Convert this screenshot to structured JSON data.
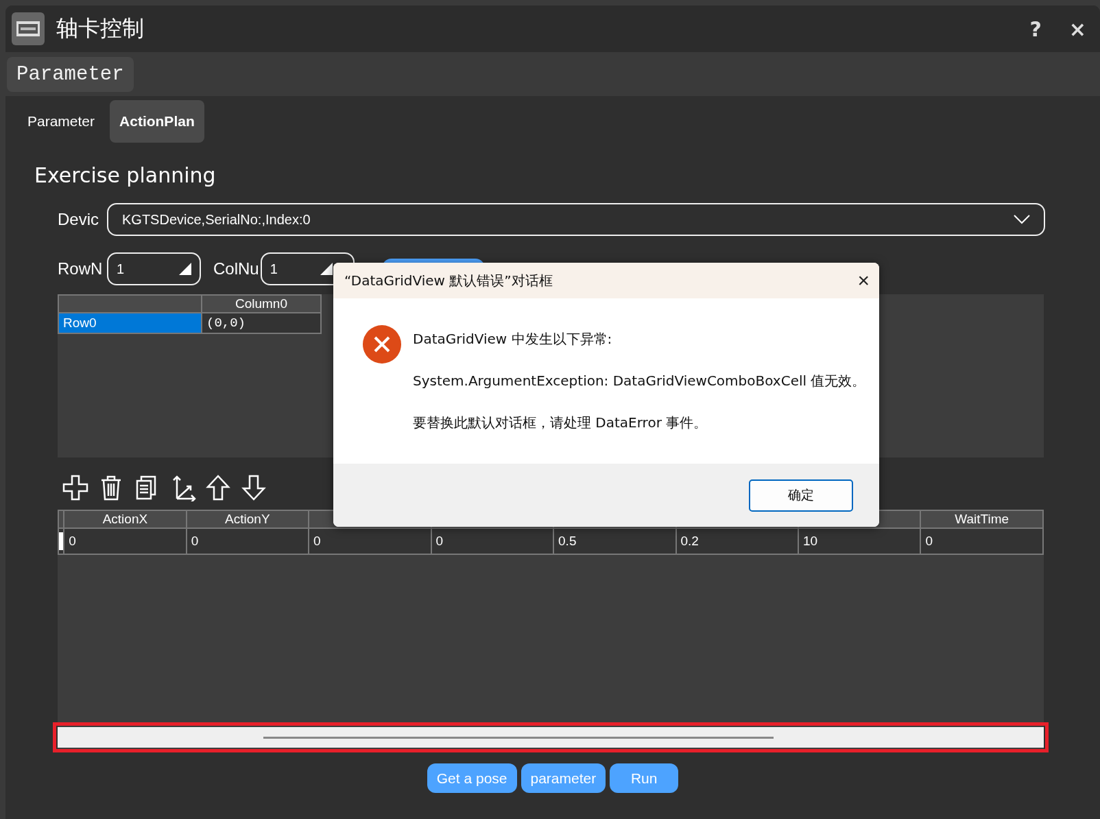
{
  "window": {
    "title": "轴卡控制",
    "help": "?",
    "close": "×"
  },
  "section_button": "Parameter",
  "tabs": [
    {
      "label": "Parameter",
      "selected": false
    },
    {
      "label": "ActionPlan",
      "selected": true
    }
  ],
  "heading": "Exercise planning",
  "device": {
    "label": "Devic",
    "value": "KGTSDevice,SerialNo:,Index:0"
  },
  "row_count": {
    "label": "RowN",
    "value": "1"
  },
  "col_count": {
    "label": "ColNu",
    "value": "1"
  },
  "position_grid": {
    "columns": [
      "Column0"
    ],
    "rows": [
      {
        "header": "Row0",
        "selected": true,
        "cells": [
          "(0,0)"
        ]
      }
    ]
  },
  "toolbar": [
    {
      "kind": "add"
    },
    {
      "kind": "delete"
    },
    {
      "kind": "copy"
    },
    {
      "kind": "axes"
    },
    {
      "kind": "up"
    },
    {
      "kind": "down"
    }
  ],
  "action_grid": {
    "columns": [
      {
        "header": "ActionX"
      },
      {
        "header": "ActionY"
      },
      {},
      {},
      {},
      {},
      {},
      {
        "header": "WaitTime"
      }
    ],
    "rows": [
      {
        "selected": true,
        "cells": [
          "0",
          "0",
          "0",
          "0",
          "0.5",
          "0.2",
          "10",
          "0"
        ]
      }
    ]
  },
  "buttons": [
    "Get a pose",
    "parameter",
    "Run"
  ],
  "dialog": {
    "title": "“DataGridView 默认错误”对话框",
    "close": "×",
    "lines": [
      "DataGridView 中发生以下异常:",
      "System.ArgumentException: DataGridViewComboBoxCell 值无效。",
      "要替换此默认对话框，请处理 DataError 事件。"
    ],
    "ok": "确定"
  }
}
